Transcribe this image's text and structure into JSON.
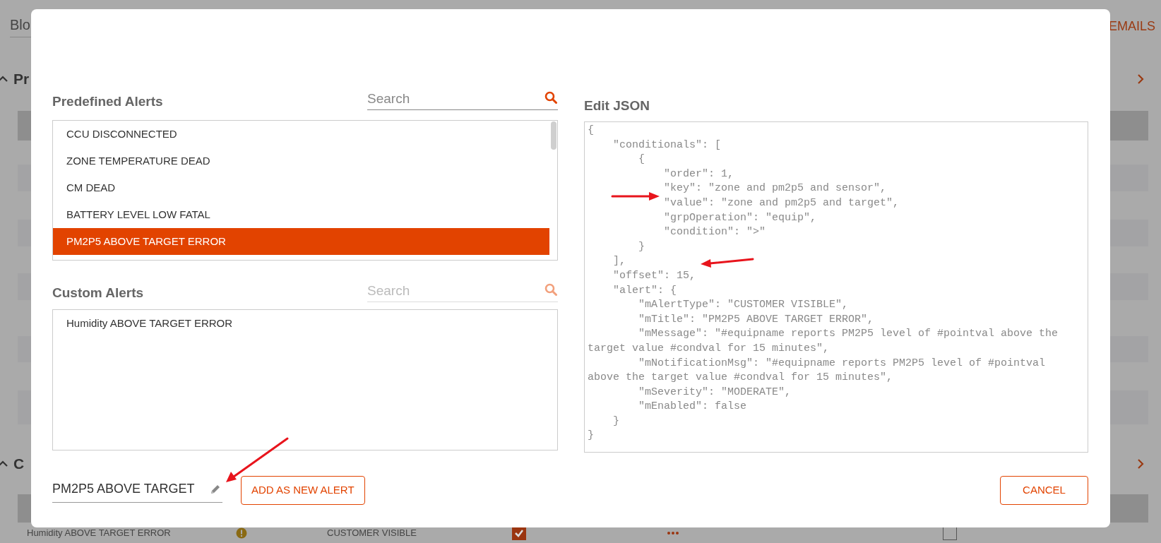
{
  "background": {
    "search_value": "Blo",
    "link": "EMAILS",
    "sections": [
      {
        "title": "Pr"
      },
      {
        "title": "C",
        "rows": [
          {
            "cells": [
              {
                "kind": "text",
                "text": "Humidity ABOVE TARGET ERROR"
              },
              {
                "kind": "info"
              },
              {
                "kind": "text",
                "text": "CUSTOMER VISIBLE"
              },
              {
                "kind": "checkbox",
                "checked": true
              },
              {
                "kind": "more"
              },
              {
                "kind": "checkbox",
                "checked": false
              }
            ]
          }
        ]
      }
    ]
  },
  "modal": {
    "predefined": {
      "title": "Predefined Alerts",
      "search": {
        "placeholder": "Search",
        "disabled": false
      },
      "items": [
        {
          "label": "CCU DISCONNECTED",
          "selected": false
        },
        {
          "label": "ZONE TEMPERATURE DEAD",
          "selected": false
        },
        {
          "label": "CM DEAD",
          "selected": false
        },
        {
          "label": "BATTERY LEVEL LOW FATAL",
          "selected": false
        },
        {
          "label": "PM2P5 ABOVE TARGET ERROR",
          "selected": true
        }
      ]
    },
    "custom": {
      "title": "Custom Alerts",
      "search": {
        "placeholder": "Search",
        "disabled": true
      },
      "items": [
        {
          "label": "Humidity ABOVE TARGET ERROR",
          "selected": false
        }
      ]
    },
    "json_editor": {
      "title": "Edit JSON",
      "text": "{\n    \"conditionals\": [\n        {\n            \"order\": 1,\n            \"key\": \"zone and pm2p5 and sensor\",\n            \"value\": \"zone and pm2p5 and target\",\n            \"grpOperation\": \"equip\",\n            \"condition\": \">\"\n        }\n    ],\n    \"offset\": 15,\n    \"alert\": {\n        \"mAlertType\": \"CUSTOMER VISIBLE\",\n        \"mTitle\": \"PM2P5 ABOVE TARGET ERROR\",\n        \"mMessage\": \"#equipname reports PM2P5 level of #pointval above the target value #condval for 15 minutes\",\n        \"mNotificationMsg\": \"#equipname reports PM2P5 level of #pointval above the target value #condval for 15 minutes\",\n        \"mSeverity\": \"MODERATE\",\n        \"mEnabled\": false\n    }\n}"
    },
    "name_field": {
      "value": "PM2P5 ABOVE TARGET"
    },
    "add_button": "ADD AS NEW ALERT",
    "cancel_button": "CANCEL"
  }
}
